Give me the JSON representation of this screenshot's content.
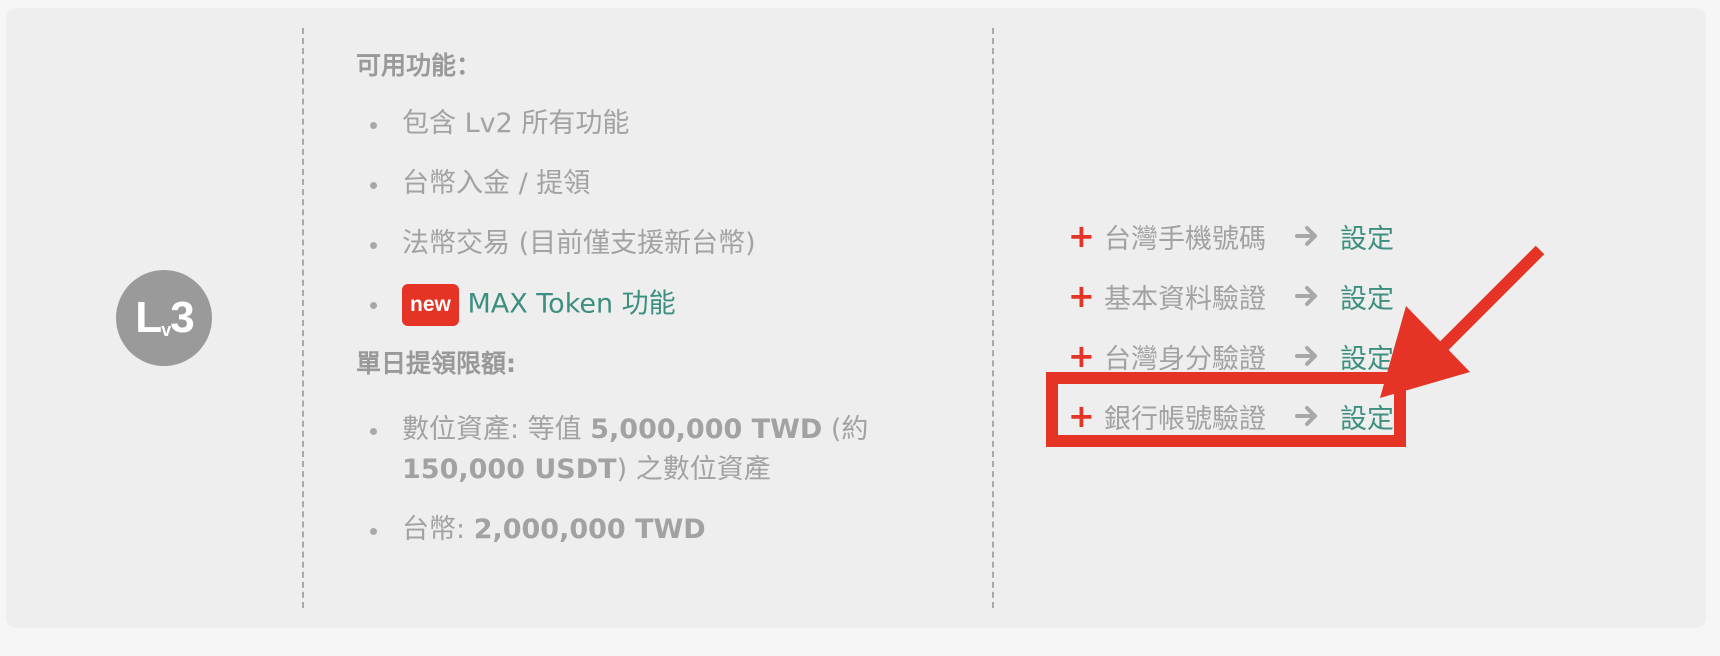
{
  "level_badge": {
    "l": "L",
    "v": "v",
    "n": "3"
  },
  "features": {
    "title": "可用功能：",
    "items": [
      "包含 Lv2 所有功能",
      "台幣入金 / 提領",
      "法幣交易 (目前僅支援新台幣)"
    ],
    "new_item": {
      "tag": "new",
      "label": "MAX Token 功能"
    }
  },
  "limits": {
    "title": "單日提領限額:",
    "crypto": {
      "prefix": "數位資產: 等值 ",
      "amount_twd": "5,000,000 TWD",
      "mid": " (約 ",
      "amount_usdt": "150,000 USDT",
      "suffix": ") 之數位資產"
    },
    "fiat": {
      "prefix": "台幣: ",
      "amount": "2,000,000 TWD"
    }
  },
  "steps": [
    {
      "label": "台灣手機號碼",
      "action": "設定"
    },
    {
      "label": "基本資料驗證",
      "action": "設定"
    },
    {
      "label": "台灣身分驗證",
      "action": "設定"
    },
    {
      "label": "銀行帳號驗證",
      "action": "設定"
    }
  ],
  "colors": {
    "accent_red": "#e53326",
    "link_green": "#3d8f80",
    "muted_text": "#a2a2a2",
    "panel_bg": "#eeeeee"
  },
  "icons": [
    "plus-icon",
    "arrow-right-icon",
    "annotation-arrow-icon"
  ]
}
